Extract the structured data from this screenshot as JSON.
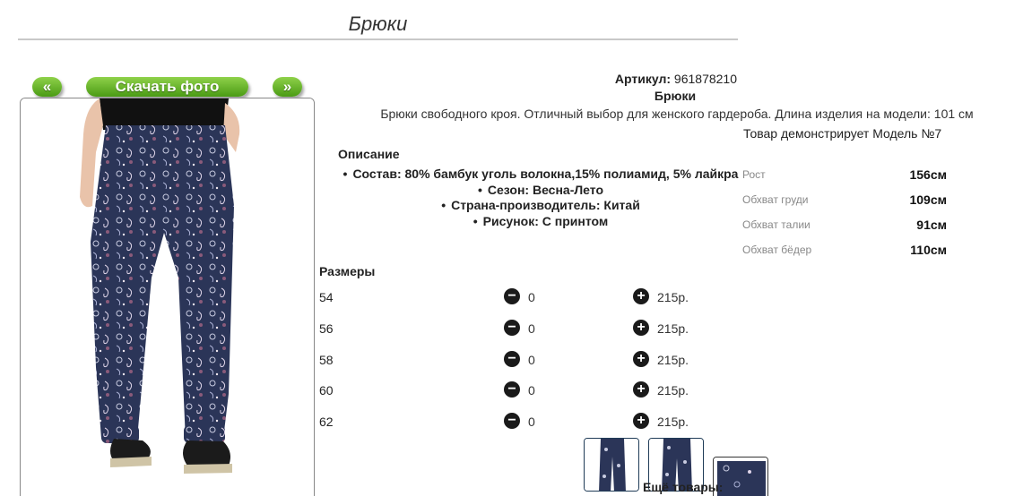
{
  "page": {
    "title": "Брюки"
  },
  "gallery": {
    "prev_label": "«",
    "download_label": "Скачать фото",
    "next_label": "»",
    "fabric_color": "#2b3558"
  },
  "product": {
    "sku_label": "Артикул:",
    "sku_value": "961878210",
    "name": "Брюки",
    "description": "Брюки свободного кроя. Отличный выбор для женского гардероба. Длина изделия на модели: 101 см",
    "model_note": "Товар демонстрирует Модель №7"
  },
  "details": {
    "heading": "Описание",
    "items": [
      "Состав: 80% бамбук уголь волокна,15% полиамид, 5% лайкра",
      "Сезон: Весна-Лето",
      "Страна-производитель: Китай",
      "Рисунок: С принтом"
    ]
  },
  "model_measures": [
    {
      "label": "Рост",
      "value": "156см"
    },
    {
      "label": "Обхват груди",
      "value": "109см"
    },
    {
      "label": "Обхват талии",
      "value": "91см"
    },
    {
      "label": "Обхват бёдер",
      "value": "110см"
    }
  ],
  "sizes": {
    "heading": "Размеры",
    "rows": [
      {
        "size": "54",
        "qty": "0",
        "price": "215р."
      },
      {
        "size": "56",
        "qty": "0",
        "price": "215р."
      },
      {
        "size": "58",
        "qty": "0",
        "price": "215р."
      },
      {
        "size": "60",
        "qty": "0",
        "price": "215р."
      },
      {
        "size": "62",
        "qty": "0",
        "price": "215р."
      }
    ]
  },
  "more": {
    "heading": "Ещё товары:"
  }
}
